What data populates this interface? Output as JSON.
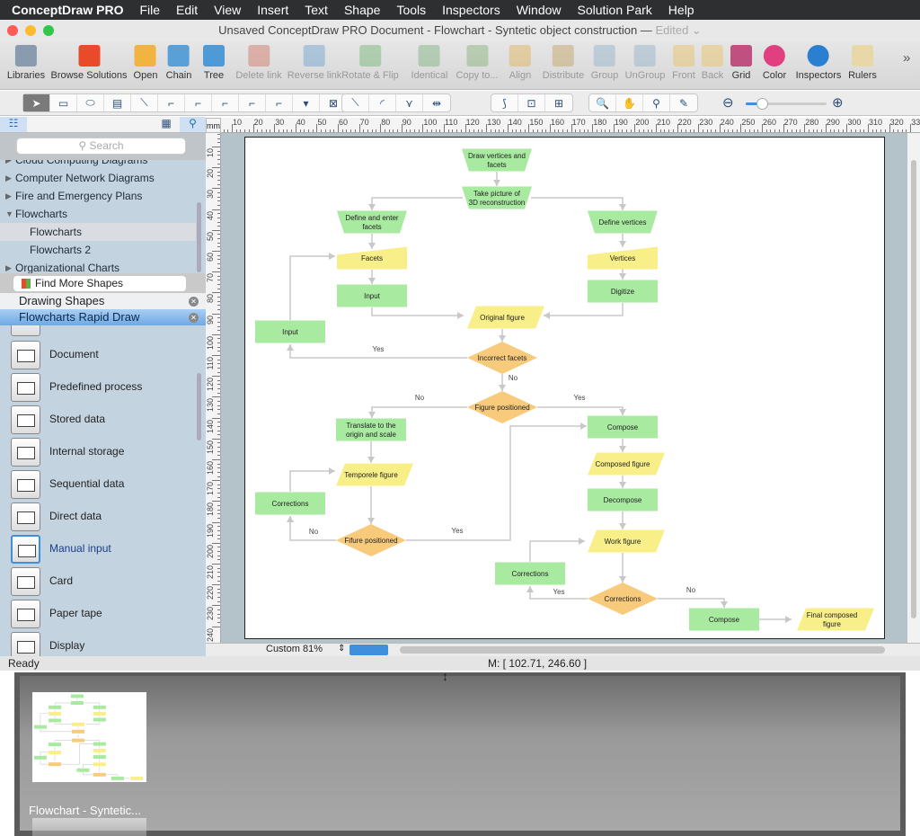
{
  "menubar": {
    "app": "ConceptDraw PRO",
    "items": [
      "File",
      "Edit",
      "View",
      "Insert",
      "Text",
      "Shape",
      "Tools",
      "Inspectors",
      "Window",
      "Solution Park",
      "Help"
    ]
  },
  "window": {
    "title": "Unsaved ConceptDraw PRO Document - Flowchart - Syntetic object construction —",
    "edited": "Edited ⌄"
  },
  "toolbar": {
    "items": [
      {
        "label": "Libraries",
        "icon": "libraries-icon",
        "color": "#8a9bb0",
        "enabled": true
      },
      {
        "label": "Browse Solutions",
        "icon": "browse-solutions-icon",
        "color": "#e84a2a",
        "enabled": true
      },
      {
        "label": "Open",
        "icon": "folder-icon",
        "color": "#f2b441",
        "enabled": true
      },
      {
        "label": "Chain",
        "icon": "chain-icon",
        "color": "#5aa0d8",
        "enabled": true
      },
      {
        "label": "Tree",
        "icon": "tree-icon",
        "color": "#4d9ad6",
        "enabled": true
      },
      {
        "label": "Delete link",
        "icon": "delete-link-icon",
        "color": "#d07060",
        "enabled": false
      },
      {
        "label": "Reverse link",
        "icon": "reverse-link-icon",
        "color": "#6aa0d0",
        "enabled": false
      },
      {
        "label": "Rotate & Flip",
        "icon": "rotate-flip-icon",
        "color": "#6fb36f",
        "enabled": false
      },
      {
        "label": "Identical",
        "icon": "identical-icon",
        "color": "#7ab07a",
        "enabled": false
      },
      {
        "label": "Copy to...",
        "icon": "copy-to-icon",
        "color": "#80b070",
        "enabled": false
      },
      {
        "label": "Align",
        "icon": "align-icon",
        "color": "#e0b050",
        "enabled": false
      },
      {
        "label": "Distribute",
        "icon": "distribute-icon",
        "color": "#c0a060",
        "enabled": false
      },
      {
        "label": "Group",
        "icon": "group-icon",
        "color": "#90b0c8",
        "enabled": false
      },
      {
        "label": "UnGroup",
        "icon": "ungroup-icon",
        "color": "#90b0c8",
        "enabled": false
      },
      {
        "label": "Front",
        "icon": "front-icon",
        "color": "#e8c060",
        "enabled": false
      },
      {
        "label": "Back",
        "icon": "back-icon",
        "color": "#e8c060",
        "enabled": false
      },
      {
        "label": "Grid",
        "icon": "grid-icon",
        "color": "#c05080",
        "enabled": true
      },
      {
        "label": "Color",
        "icon": "color-wheel-icon",
        "color": "#e04080",
        "enabled": true
      },
      {
        "label": "Inspectors",
        "icon": "info-icon",
        "color": "#2a7fd0",
        "enabled": true
      },
      {
        "label": "Rulers",
        "icon": "rulers-icon",
        "color": "#e8d8a8",
        "enabled": true
      }
    ],
    "more": "»"
  },
  "drawtools": {
    "g1": [
      "➤",
      "▭",
      "⬭",
      "▤",
      "⟍",
      "⌐",
      "⌐",
      "⌐",
      "⌐",
      "⌐",
      "▾",
      "⊠"
    ],
    "g2": [
      "⟍",
      "◜",
      "⋎",
      "⇹"
    ],
    "g3": [
      "⟆",
      "⊡",
      "⊞"
    ],
    "g4": [
      "🔍",
      "✋",
      "⚲",
      "✎"
    ],
    "zoom_out": "⊖",
    "zoom_in": "⊕",
    "zoom_level": 0.2
  },
  "sidebar": {
    "search_placeholder": "Search",
    "tree": [
      {
        "label": "Cloud Computing Diagrams",
        "arrow": "▶"
      },
      {
        "label": "Computer Network Diagrams",
        "arrow": "▶"
      },
      {
        "label": "Fire and Emergency Plans",
        "arrow": "▶"
      },
      {
        "label": "Flowcharts",
        "arrow": "▼"
      },
      {
        "label": "Flowcharts",
        "arrow": ""
      },
      {
        "label": "Flowcharts 2",
        "arrow": ""
      },
      {
        "label": "Organizational Charts",
        "arrow": "▶"
      }
    ],
    "find_more": "Find More Shapes",
    "libraries": [
      "Drawing Shapes",
      "Flowcharts Rapid Draw"
    ],
    "shapes": [
      "Document",
      "Predefined process",
      "Stored data",
      "Internal storage",
      "Sequential data",
      "Direct data",
      "Manual input",
      "Card",
      "Paper tape",
      "Display"
    ],
    "selected_shape": "Manual input",
    "ruler_unit": "mm"
  },
  "colors": {
    "process": "#a8eaa0",
    "io": "#f8ef88",
    "decision": "#f8ca7c",
    "connector": "#c8c8c8",
    "selection": "#3f8fdc"
  },
  "diagram": {
    "nodes": [
      {
        "id": "n1",
        "text": "Draw vertices and facets",
        "type": "manual-operation"
      },
      {
        "id": "n2",
        "text": "Take picture of 3D reconstruction",
        "type": "manual-operation"
      },
      {
        "id": "n3",
        "text": "Define and enter facets",
        "type": "manual-operation"
      },
      {
        "id": "n4",
        "text": "Define vertices",
        "type": "manual-operation"
      },
      {
        "id": "n5",
        "text": "Facets",
        "type": "manual-input"
      },
      {
        "id": "n6",
        "text": "Vertices",
        "type": "manual-input"
      },
      {
        "id": "n7",
        "text": "Input",
        "type": "process"
      },
      {
        "id": "n8",
        "text": "Digitize",
        "type": "process"
      },
      {
        "id": "n9",
        "text": "Original figure",
        "type": "data"
      },
      {
        "id": "n10",
        "text": "Input",
        "type": "process"
      },
      {
        "id": "n11",
        "text": "Incorrect facets",
        "type": "decision"
      },
      {
        "id": "n12",
        "text": "Figure positioned",
        "type": "decision"
      },
      {
        "id": "n13",
        "text": "Translate to the origin and scale",
        "type": "process"
      },
      {
        "id": "n14",
        "text": "Compose",
        "type": "process"
      },
      {
        "id": "n15",
        "text": "Temporele figure",
        "type": "data"
      },
      {
        "id": "n16",
        "text": "Composed figure",
        "type": "data"
      },
      {
        "id": "n17",
        "text": "Corrections",
        "type": "process"
      },
      {
        "id": "n18",
        "text": "Decompose",
        "type": "process"
      },
      {
        "id": "n19",
        "text": "Fifure positioned",
        "type": "decision"
      },
      {
        "id": "n20",
        "text": "Work figure",
        "type": "data"
      },
      {
        "id": "n21",
        "text": "Corrections",
        "type": "process"
      },
      {
        "id": "n22",
        "text": "Corrections",
        "type": "decision"
      },
      {
        "id": "n23",
        "text": "Compose",
        "type": "process"
      },
      {
        "id": "n24",
        "text": "Final composed figure",
        "type": "data"
      }
    ],
    "edges": [
      {
        "from": "n1",
        "to": "n2",
        "label": ""
      },
      {
        "from": "n2",
        "to": "n3",
        "label": ""
      },
      {
        "from": "n2",
        "to": "n4",
        "label": ""
      },
      {
        "from": "n3",
        "to": "n5",
        "label": ""
      },
      {
        "from": "n4",
        "to": "n6",
        "label": ""
      },
      {
        "from": "n5",
        "to": "n7",
        "label": ""
      },
      {
        "from": "n6",
        "to": "n8",
        "label": ""
      },
      {
        "from": "n7",
        "to": "n9",
        "label": ""
      },
      {
        "from": "n8",
        "to": "n9",
        "label": ""
      },
      {
        "from": "n9",
        "to": "n11",
        "label": ""
      },
      {
        "from": "n11",
        "to": "n10",
        "label": "Yes"
      },
      {
        "from": "n10",
        "to": "n5",
        "label": ""
      },
      {
        "from": "n11",
        "to": "n12",
        "label": "No"
      },
      {
        "from": "n12",
        "to": "n13",
        "label": "No"
      },
      {
        "from": "n12",
        "to": "n14",
        "label": "Yes"
      },
      {
        "from": "n13",
        "to": "n15",
        "label": ""
      },
      {
        "from": "n15",
        "to": "n19",
        "label": ""
      },
      {
        "from": "n19",
        "to": "n17",
        "label": "No"
      },
      {
        "from": "n17",
        "to": "n15",
        "label": ""
      },
      {
        "from": "n19",
        "to": "n14",
        "label": "Yes"
      },
      {
        "from": "n14",
        "to": "n16",
        "label": ""
      },
      {
        "from": "n16",
        "to": "n18",
        "label": ""
      },
      {
        "from": "n18",
        "to": "n20",
        "label": ""
      },
      {
        "from": "n20",
        "to": "n22",
        "label": ""
      },
      {
        "from": "n22",
        "to": "n21",
        "label": "Yes"
      },
      {
        "from": "n21",
        "to": "n20",
        "label": ""
      },
      {
        "from": "n22",
        "to": "n23",
        "label": "No"
      },
      {
        "from": "n23",
        "to": "n24",
        "label": ""
      }
    ]
  },
  "bottom": {
    "zoom": "Custom 81%"
  },
  "status": {
    "text": "Ready",
    "mouse": "M: [ 102.71, 246.60 ]"
  },
  "thumbnails": [
    {
      "label": "Flowchart - Syntetic..."
    }
  ]
}
